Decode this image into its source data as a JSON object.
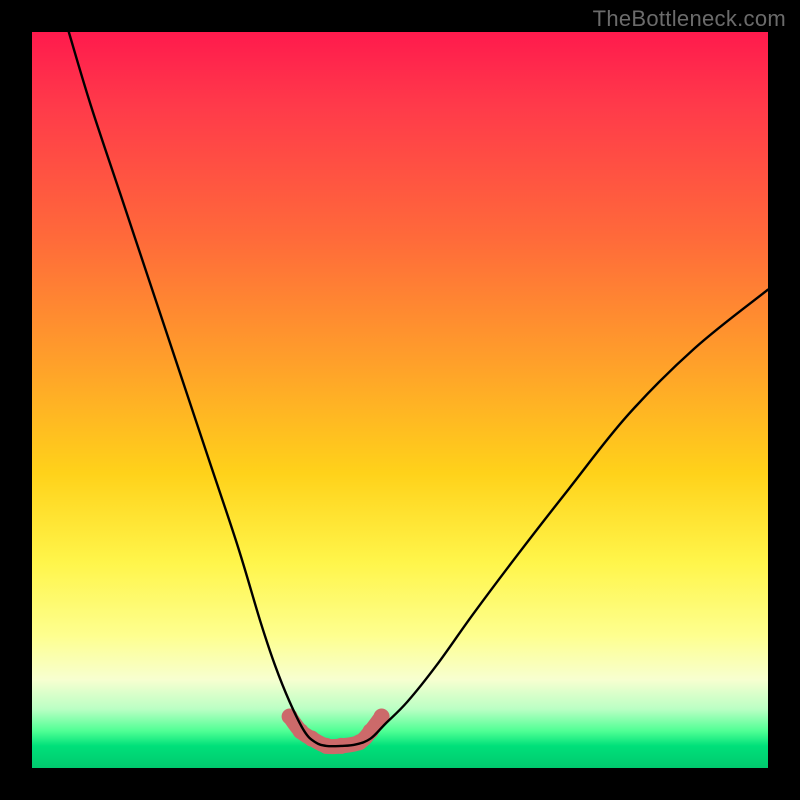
{
  "watermark": "TheBottleneck.com",
  "chart_data": {
    "type": "line",
    "title": "",
    "xlabel": "",
    "ylabel": "",
    "xlim": [
      0,
      100
    ],
    "ylim": [
      0,
      100
    ],
    "series": [
      {
        "name": "bottleneck-curve",
        "x": [
          5,
          8,
          12,
          16,
          20,
          24,
          28,
          31,
          33,
          35,
          37,
          38.5,
          40,
          42,
          44,
          46,
          48,
          51,
          55,
          60,
          66,
          73,
          81,
          90,
          100
        ],
        "y": [
          100,
          90,
          78,
          66,
          54,
          42,
          30,
          20,
          14,
          9,
          5,
          3.5,
          3,
          3,
          3.2,
          4,
          6,
          9,
          14,
          21,
          29,
          38,
          48,
          57,
          65
        ]
      },
      {
        "name": "valley-markers",
        "x": [
          35,
          36.5,
          38,
          40,
          42,
          44.5,
          46,
          47.5
        ],
        "y": [
          7,
          5,
          4,
          3,
          3,
          3.5,
          5,
          7
        ]
      }
    ],
    "colors": {
      "curve": "#000000",
      "markers": "#cc6a6a"
    }
  }
}
